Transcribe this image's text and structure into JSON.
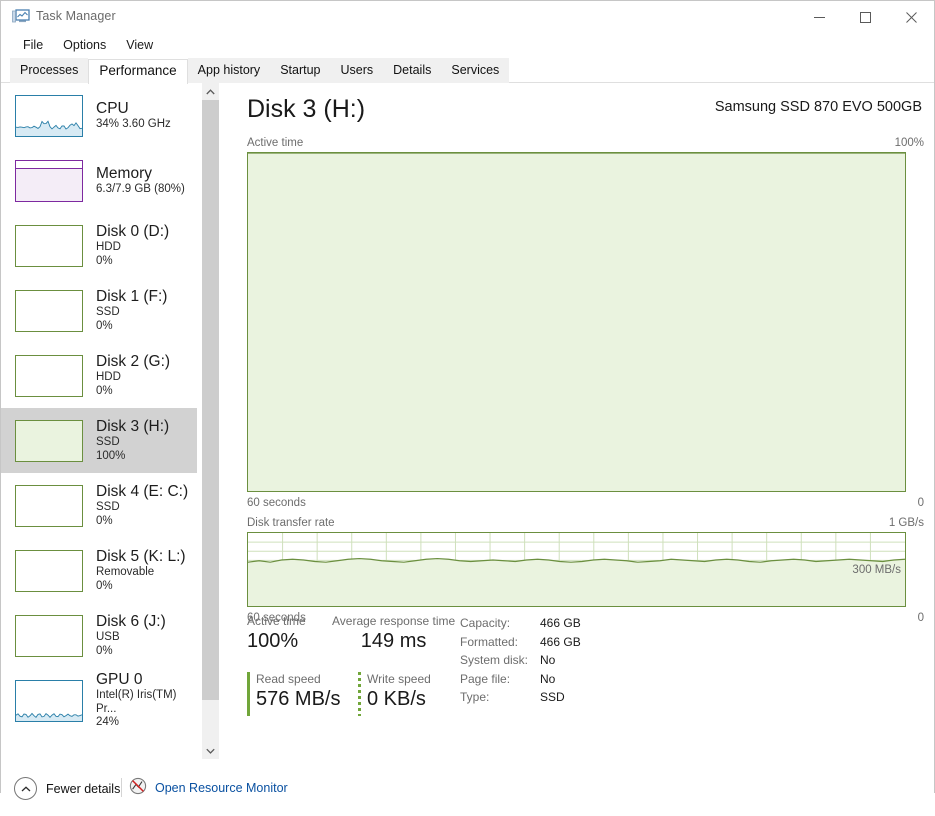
{
  "window": {
    "title": "Task Manager",
    "icon": "task-manager-icon",
    "buttons": {
      "minimize": "—",
      "maximize": "□",
      "close": "✕"
    }
  },
  "menu": {
    "items": [
      "File",
      "Options",
      "View"
    ]
  },
  "tabs": {
    "active": "Performance",
    "items": [
      "Processes",
      "Performance",
      "App history",
      "Startup",
      "Users",
      "Details",
      "Services"
    ]
  },
  "sidebar": {
    "items": [
      {
        "title": "CPU",
        "sub1": "34%  3.60 GHz",
        "sub2": "",
        "kind": "cpu",
        "color": "#2a7fa8",
        "fill": "#d7eaf4",
        "level": 22,
        "selected": false
      },
      {
        "title": "Memory",
        "sub1": "6.3/7.9 GB (80%)",
        "sub2": "",
        "kind": "memory",
        "color": "#7d29a0",
        "fill": "#f4edf7",
        "level": 80,
        "selected": false
      },
      {
        "title": "Disk 0 (D:)",
        "sub1": "HDD",
        "sub2": "0%",
        "kind": "disk",
        "color": "#6b8f3f",
        "fill": "#eaf3df",
        "level": 0,
        "selected": false
      },
      {
        "title": "Disk 1 (F:)",
        "sub1": "SSD",
        "sub2": "0%",
        "kind": "disk",
        "color": "#6b8f3f",
        "fill": "#eaf3df",
        "level": 0,
        "selected": false
      },
      {
        "title": "Disk 2 (G:)",
        "sub1": "HDD",
        "sub2": "0%",
        "kind": "disk",
        "color": "#6b8f3f",
        "fill": "#eaf3df",
        "level": 0,
        "selected": false
      },
      {
        "title": "Disk 3 (H:)",
        "sub1": "SSD",
        "sub2": "100%",
        "kind": "disk",
        "color": "#6b8f3f",
        "fill": "#eaf3df",
        "level": 100,
        "selected": true
      },
      {
        "title": "Disk 4 (E: C:)",
        "sub1": "SSD",
        "sub2": "0%",
        "kind": "disk",
        "color": "#6b8f3f",
        "fill": "#eaf3df",
        "level": 0,
        "selected": false
      },
      {
        "title": "Disk 5 (K: L:)",
        "sub1": "Removable",
        "sub2": "0%",
        "kind": "disk",
        "color": "#6b8f3f",
        "fill": "#eaf3df",
        "level": 0,
        "selected": false
      },
      {
        "title": "Disk 6 (J:)",
        "sub1": "USB",
        "sub2": "0%",
        "kind": "disk",
        "color": "#6b8f3f",
        "fill": "#eaf3df",
        "level": 0,
        "selected": false
      },
      {
        "title": "GPU 0",
        "sub1": "Intel(R) Iris(TM) Pr...",
        "sub2": "24%",
        "kind": "gpu",
        "color": "#2a7fa8",
        "fill": "#d7eaf4",
        "level": 14,
        "selected": false
      }
    ]
  },
  "main": {
    "title": "Disk 3 (H:)",
    "device": "Samsung SSD 870 EVO 500GB",
    "active_graph": {
      "label": "Active time",
      "max_label": "100%",
      "min_label": "0",
      "time_label": "60 seconds"
    },
    "rate_graph": {
      "label": "Disk transfer rate",
      "max_label": "1 GB/s",
      "min_label": "0",
      "time_label": "60 seconds",
      "inline_label": "300 MB/s"
    }
  },
  "stats": {
    "active_time": {
      "label": "Active time",
      "value": "100%"
    },
    "response_time": {
      "label": "Average response time",
      "value": "149 ms"
    },
    "read_speed": {
      "label": "Read speed",
      "value": "576 MB/s"
    },
    "write_speed": {
      "label": "Write speed",
      "value": "0 KB/s"
    },
    "details": [
      {
        "key": "Capacity:",
        "value": "466 GB"
      },
      {
        "key": "Formatted:",
        "value": "466 GB"
      },
      {
        "key": "System disk:",
        "value": "No"
      },
      {
        "key": "Page file:",
        "value": "No"
      },
      {
        "key": "Type:",
        "value": "SSD"
      }
    ]
  },
  "footer": {
    "fewer_details": "Fewer details",
    "resource_monitor": "Open Resource Monitor"
  },
  "chart_data": [
    {
      "type": "area",
      "title": "Active time",
      "ylabel": "%",
      "xlabel": "60 seconds",
      "ylim": [
        0,
        100
      ],
      "values": [
        100,
        100,
        100,
        100,
        100,
        100,
        100,
        100,
        100,
        100,
        100,
        100,
        100,
        100,
        100,
        100,
        100,
        100,
        100,
        100,
        100,
        100,
        100,
        100,
        100,
        100,
        100,
        100,
        100,
        100,
        100,
        100,
        100,
        100,
        100,
        100,
        100,
        100,
        100,
        100,
        100,
        100,
        100,
        100,
        100,
        100,
        100,
        100,
        100,
        100,
        100,
        100,
        100,
        100,
        100,
        100,
        100,
        100,
        100,
        100
      ],
      "grid": true,
      "color": "#6b8f3f",
      "fill": "#eaf3df"
    },
    {
      "type": "area",
      "title": "Disk transfer rate",
      "ylabel": "GB/s",
      "xlabel": "60 seconds",
      "ylim": [
        0,
        1
      ],
      "annotation": "300 MB/s",
      "values": [
        0.6,
        0.62,
        0.6,
        0.63,
        0.64,
        0.63,
        0.61,
        0.6,
        0.62,
        0.64,
        0.65,
        0.64,
        0.62,
        0.61,
        0.6,
        0.62,
        0.64,
        0.65,
        0.64,
        0.62,
        0.61,
        0.62,
        0.63,
        0.62,
        0.61,
        0.63,
        0.64,
        0.63,
        0.61,
        0.6,
        0.61,
        0.63,
        0.64,
        0.63,
        0.62,
        0.6,
        0.61,
        0.62,
        0.64,
        0.63,
        0.62,
        0.61,
        0.63,
        0.64,
        0.63,
        0.61,
        0.6,
        0.62,
        0.63,
        0.64,
        0.63,
        0.61,
        0.62,
        0.63,
        0.64,
        0.63,
        0.62,
        0.61,
        0.63,
        0.64
      ],
      "grid": true,
      "color": "#6b8f3f",
      "fill": "#eaf3df"
    }
  ]
}
